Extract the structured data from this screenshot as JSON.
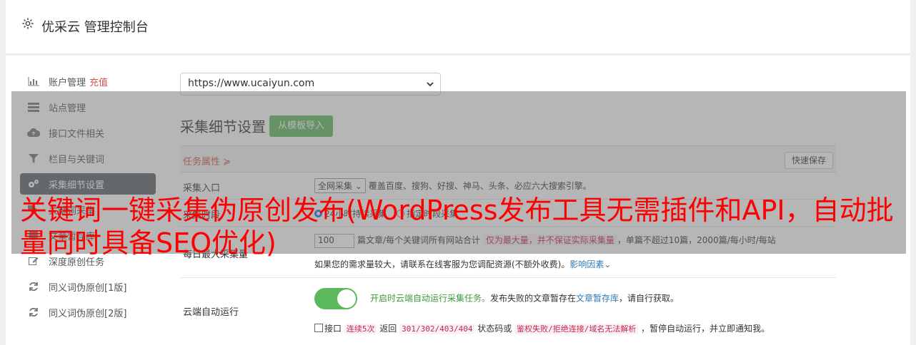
{
  "header": {
    "title": "优采云 管理控制台",
    "icon": "gear-icon"
  },
  "sidebar": {
    "items": [
      {
        "label": "账户管理",
        "extra": "充值",
        "icon": "bar-chart-icon"
      },
      {
        "label": "站点管理",
        "icon": "server-icon"
      },
      {
        "label": "接口文件相关",
        "icon": "cloud-upload-icon"
      },
      {
        "label": "栏目与关键词",
        "icon": "filter-icon"
      },
      {
        "label": "采集细节设置",
        "icon": "gears-icon",
        "active": true
      },
      {
        "label": "关键词采集",
        "icon": "tags-icon"
      },
      {
        "label": "文章暂存库",
        "icon": "database-icon"
      },
      {
        "label": "深度原创任务",
        "icon": "edit-icon"
      },
      {
        "label": "同义词伪原创[1版]",
        "icon": "refresh-icon"
      },
      {
        "label": "同义词伪原创[2版]",
        "icon": "refresh-icon"
      }
    ]
  },
  "site_select": {
    "value": "https://www.ucaiyun.com"
  },
  "section": {
    "title": "采集细节设置",
    "import_button": "从模板导入",
    "task_attr": "任务属性 ≽",
    "save_button": "快速保存"
  },
  "rows": {
    "entry": {
      "label": "采集入口",
      "select": "全网采集",
      "desc": "覆盖百度、搜狗、好搜、神马、头条、必应六大搜索引擎。"
    },
    "period": {
      "label": "采集时段",
      "opt1": "24小时持续采集",
      "opt2": "指定时段采集"
    },
    "max": {
      "label": "每日最大采集量",
      "input": "100",
      "text1": "篇文章/每个关键词所有网站合计",
      "pink": "仅为最大量，并不保证实际采集量",
      "text2": "，单篇不超过10篇，2000篇/每小时/每站",
      "note": "如果您的需求量较大，请联系在线客服为您调配资源(不额外收费)。",
      "note_link": "影响因素"
    },
    "cloud": {
      "label": "云端自动运行",
      "green": "开启时云端自动运行采集任务。",
      "text1": "发布失败的文章暂存在",
      "link": "文章暂存库",
      "text2": "，请自行获取。",
      "chk_label": "接口",
      "code1": "连续5次",
      "text3": " 返回 ",
      "code2": "301/302/403/404",
      "text4": " 状态码或 ",
      "code3": "鉴权失败/拒绝连接/域名无法解析",
      "text5": " ，暂停自动运行，并立即通知我。"
    }
  },
  "overlay_headline": "关键词一键采集伪原创发布(WordPress发布工具无需插件和API，自动批量同时具备SEO优化)",
  "colors": {
    "accent_green": "#5cb85c",
    "headline_red": "#ff0000",
    "active_bg": "#5a6268"
  }
}
